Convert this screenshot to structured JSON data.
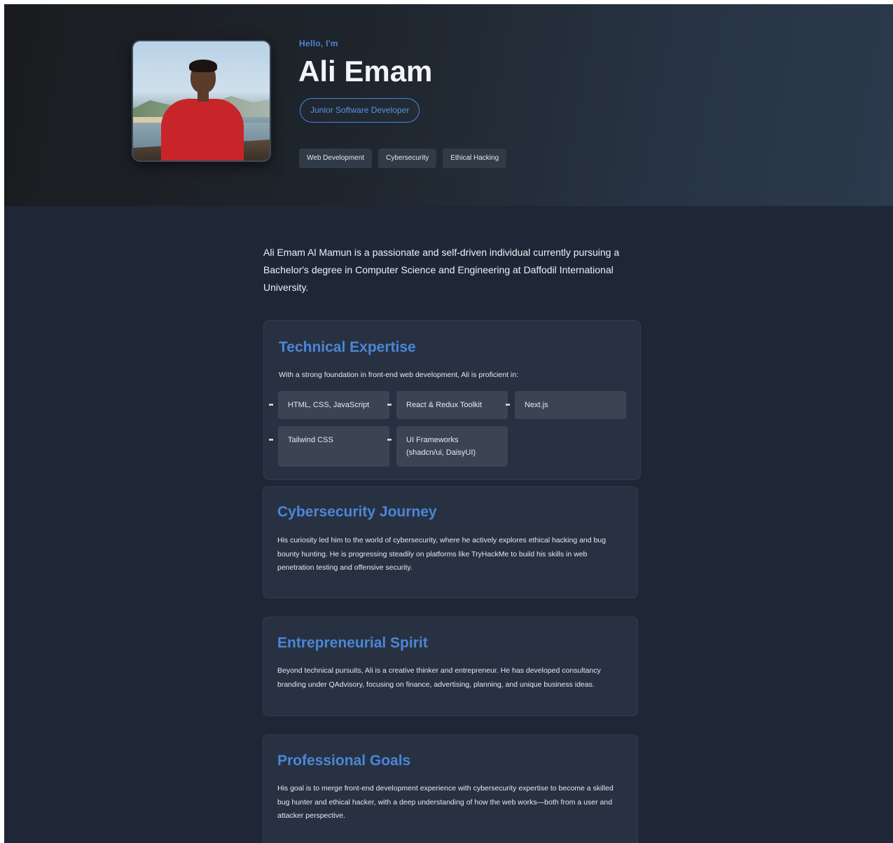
{
  "hero": {
    "greeting": "Hello, I'm",
    "name": "Ali Emam",
    "role": "Junior Software Developer",
    "tags": [
      "Web Development",
      "Cybersecurity",
      "Ethical Hacking"
    ]
  },
  "about": {
    "bio": "Ali Emam Al Mamun is a passionate and self-driven individual currently pursuing a Bachelor's degree in Computer Science and Engineering at Daffodil International University."
  },
  "sections": {
    "technical": {
      "title": "Technical Expertise",
      "intro": "With a strong foundation in front-end web development, Ali is proficient in:",
      "skills": [
        "HTML, CSS, JavaScript",
        "React & Redux Toolkit",
        "Next.js",
        "Tailwind CSS",
        "UI Frameworks (shadcn/ui, DaisyUI)"
      ]
    },
    "cyber": {
      "title": "Cybersecurity Journey",
      "body": "His curiosity led him to the world of cybersecurity, where he actively explores ethical hacking and bug bounty hunting. He is progressing steadily on platforms like TryHackMe to build his skills in web penetration testing and offensive security."
    },
    "entrepreneur": {
      "title": "Entrepreneurial Spirit",
      "body": "Beyond technical pursuits, Ali is a creative thinker and entrepreneur. He has developed consultancy branding under QAdvisory, focusing on finance, advertising, planning, and unique business ideas."
    },
    "goals": {
      "title": "Professional Goals",
      "body": "His goal is to merge front-end development experience with cybersecurity expertise to become a skilled bug hunter and ethical hacker, with a deep understanding of how the web works—both from a user and attacker perspective."
    }
  },
  "colors": {
    "accent": "#4b86d6",
    "page_bg": "#1f2737",
    "card_bg": "#283142"
  }
}
